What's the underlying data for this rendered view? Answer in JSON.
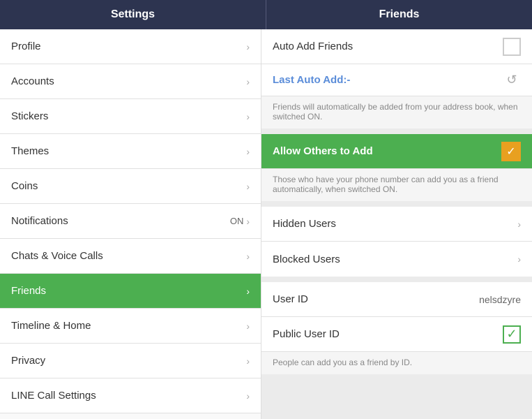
{
  "header": {
    "left_title": "Settings",
    "right_title": "Friends"
  },
  "left_menu": {
    "items": [
      {
        "label": "Profile",
        "badge": "",
        "active": false
      },
      {
        "label": "Accounts",
        "badge": "",
        "active": false
      },
      {
        "label": "Stickers",
        "badge": "",
        "active": false
      },
      {
        "label": "Themes",
        "badge": "",
        "active": false
      },
      {
        "label": "Coins",
        "badge": "",
        "active": false
      },
      {
        "label": "Notifications",
        "badge": "ON",
        "active": false
      },
      {
        "label": "Chats & Voice Calls",
        "badge": "",
        "active": false
      },
      {
        "label": "Friends",
        "badge": "",
        "active": true
      },
      {
        "label": "Timeline & Home",
        "badge": "",
        "active": false
      },
      {
        "label": "Privacy",
        "badge": "",
        "active": false
      },
      {
        "label": "LINE Call Settings",
        "badge": "",
        "active": false
      }
    ]
  },
  "right_panel": {
    "auto_add_label": "Auto Add Friends",
    "last_auto_add_label": "Last Auto Add:-",
    "description_auto": "Friends will automatically be added from your address book, when switched ON.",
    "allow_others_label": "Allow Others to Add",
    "description_allow": "Those who have your phone number can add you as a friend automatically, when switched ON.",
    "hidden_users_label": "Hidden Users",
    "blocked_users_label": "Blocked Users",
    "user_id_label": "User ID",
    "user_id_value": "nelsdzyre",
    "public_user_id_label": "Public User ID",
    "people_can_add_text": "People can add you as a friend by ID."
  }
}
